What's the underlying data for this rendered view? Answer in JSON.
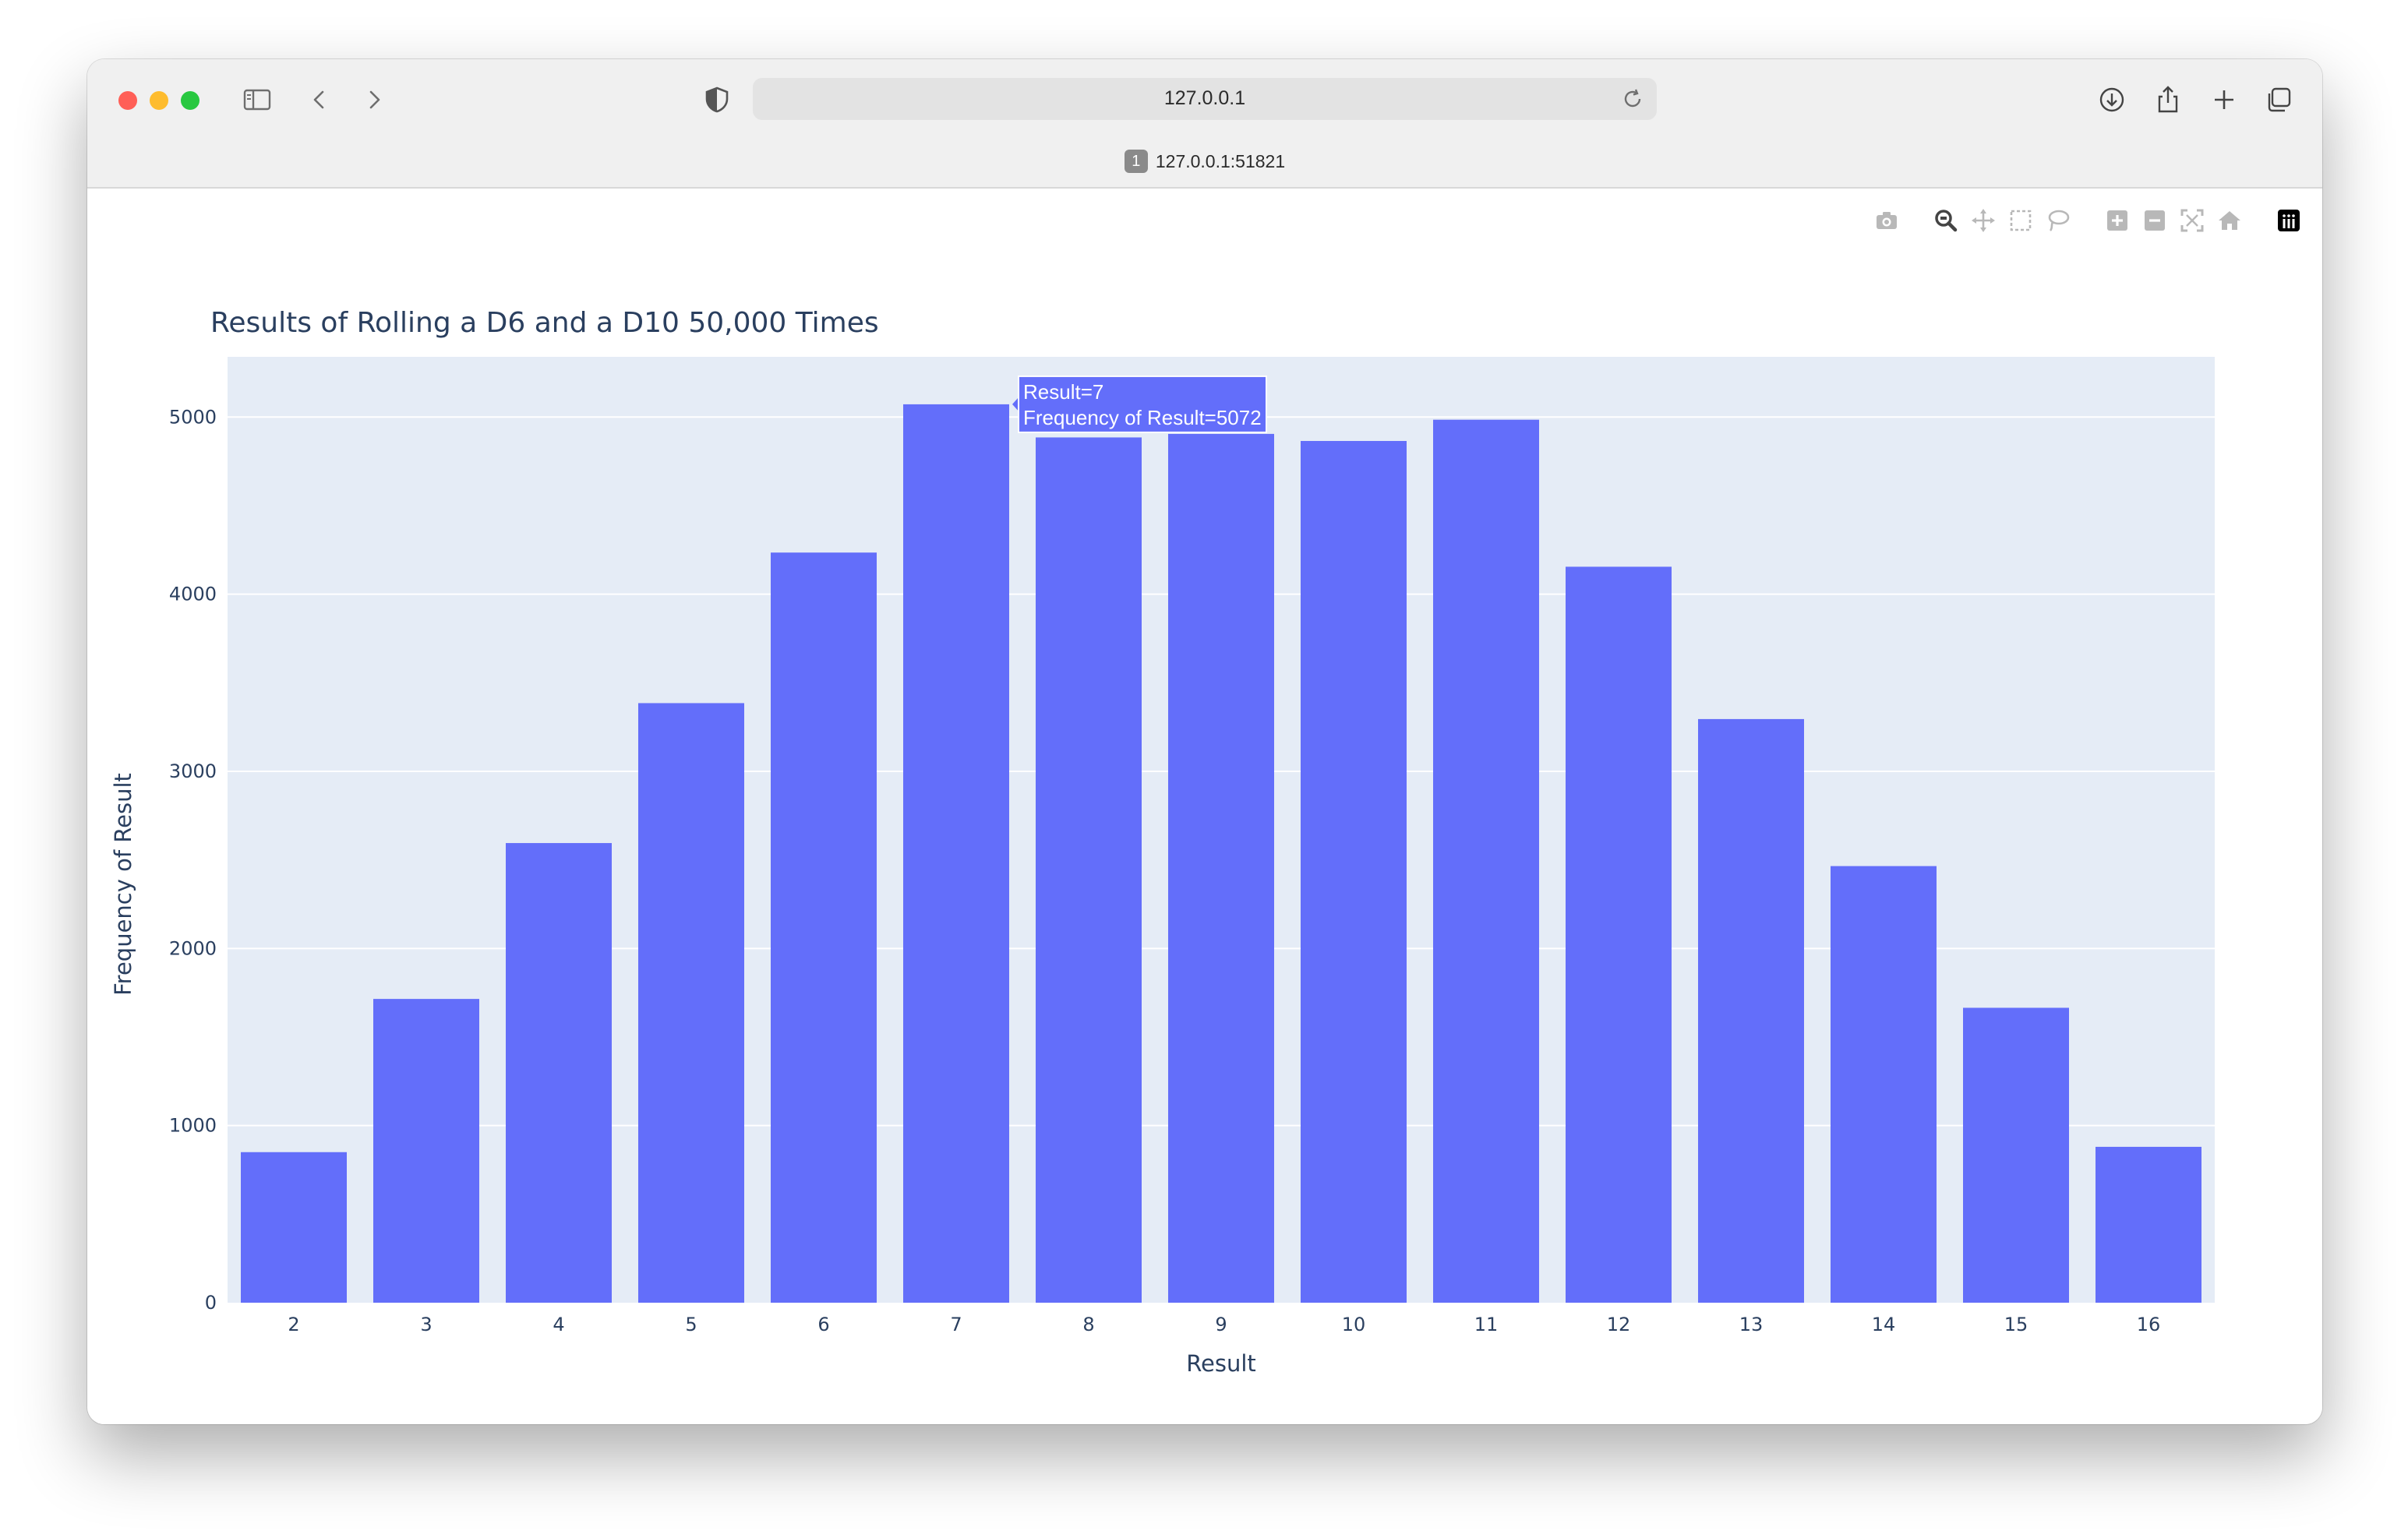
{
  "browser": {
    "address": "127.0.0.1",
    "tab_badge": "1",
    "tab_title": "127.0.0.1:51821"
  },
  "modebar": {
    "buttons": [
      "camera-icon",
      "zoom-icon",
      "pan-icon",
      "box-select-icon",
      "lasso-select-icon",
      "zoom-in-icon",
      "zoom-out-icon",
      "autoscale-icon",
      "reset-axes-icon",
      "plotly-logo-icon"
    ]
  },
  "chart": {
    "title": "Results of Rolling a D6 and a D10 50,000 Times"
  },
  "tooltip": {
    "line1": "Result=7",
    "line2": "Frequency of Result=5072"
  },
  "colors": {
    "bar": "#636efa",
    "plot_bg": "#e5ecf6",
    "grid": "#ffffff",
    "text": "#2a3f5f"
  },
  "chart_data": {
    "type": "bar",
    "title": "Results of Rolling a D6 and a D10 50,000 Times",
    "xlabel": "Result",
    "ylabel": "Frequency of Result",
    "categories": [
      "2",
      "3",
      "4",
      "5",
      "6",
      "7",
      "8",
      "9",
      "10",
      "11",
      "12",
      "13",
      "14",
      "15",
      "16"
    ],
    "values": [
      850,
      1715,
      2595,
      3385,
      4235,
      5072,
      4885,
      4905,
      4865,
      4985,
      4155,
      3295,
      2465,
      1665,
      880
    ],
    "ylim": [
      0,
      5340
    ],
    "yticks": [
      0,
      1000,
      2000,
      3000,
      4000,
      5000
    ],
    "grid": true,
    "legend": "none",
    "hovered_category": "7"
  }
}
